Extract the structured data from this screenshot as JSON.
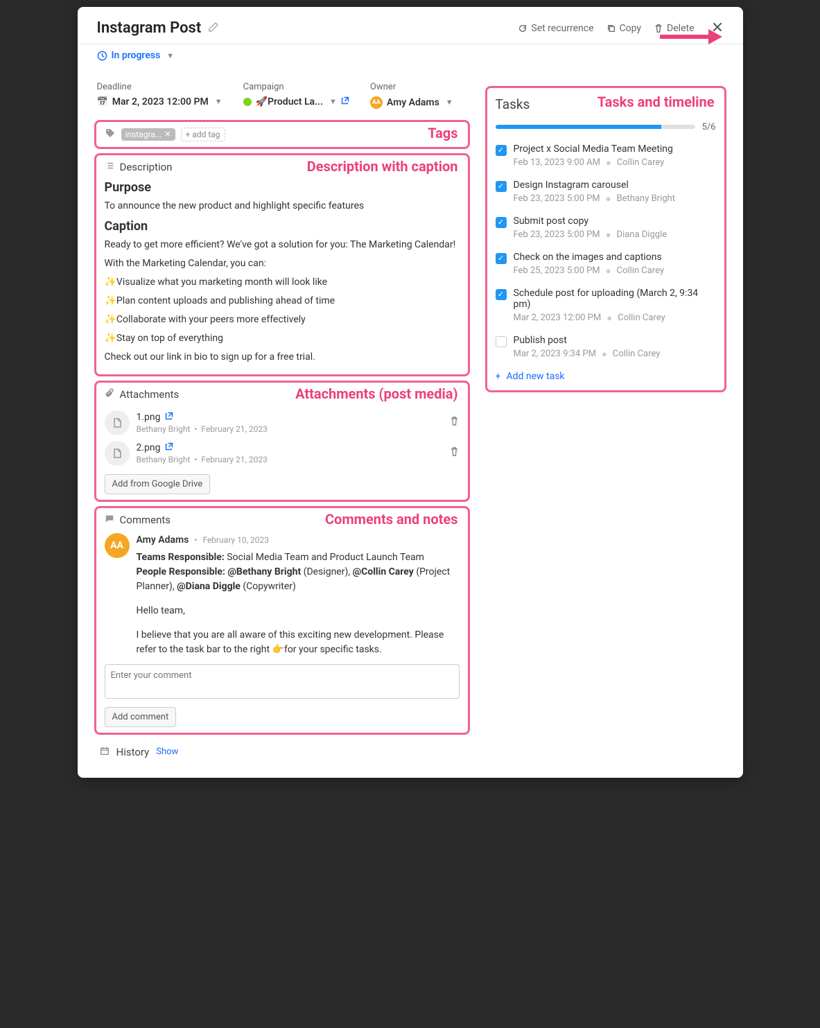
{
  "header": {
    "title": "Instagram Post",
    "set_recurrence": "Set recurrence",
    "copy": "Copy",
    "delete": "Delete"
  },
  "status": {
    "label": "In progress"
  },
  "meta": {
    "deadline_label": "Deadline",
    "deadline_value": "Mar 2, 2023 12:00 PM",
    "campaign_label": "Campaign",
    "campaign_value": "🚀Product La...",
    "campaign_color": "#7ed321",
    "owner_label": "Owner",
    "owner_name": "Amy Adams",
    "owner_initials": "AA"
  },
  "tags": {
    "anno": "Tags",
    "chip": "instagra...",
    "add_label": "add tag"
  },
  "description": {
    "anno": "Description with caption",
    "section": "Description",
    "h1": "Purpose",
    "p1": "To announce the new product and highlight specific features",
    "h2": "Caption",
    "p2": "Ready to get more efficient? We've got a solution for you: The Marketing Calendar!",
    "p3": "With the Marketing Calendar, you can:",
    "b1": "✨Visualize what you marketing month will look like",
    "b2": "✨Plan content uploads and publishing ahead of time",
    "b3": "✨Collaborate with your peers more effectively",
    "b4": "✨Stay on top of everything",
    "p4": "Check out our link in bio to sign up for a free trial."
  },
  "attachments": {
    "anno": "Attachments (post media)",
    "section": "Attachments",
    "items": [
      {
        "name": "1.png",
        "author": "Bethany Bright",
        "date": "February 21, 2023"
      },
      {
        "name": "2.png",
        "author": "Bethany Bright",
        "date": "February 21, 2023"
      }
    ],
    "gdrive": "Add from Google Drive"
  },
  "comments": {
    "anno": "Comments and notes",
    "section": "Comments",
    "author": "Amy Adams",
    "initials": "AA",
    "date": "February 10, 2023",
    "teams_label": "Teams Responsible:",
    "teams_value": "Social Media Team and Product Launch Team",
    "people_label": "People Responsible:",
    "p1": "@Bethany Bright",
    "p1r": "(Designer),",
    "p2": "@Collin Carey",
    "p2r": "(Project Planner),",
    "p3": "@Diana Diggle",
    "p3r": "(Copywriter)",
    "greeting": "Hello team,",
    "body": "I believe that you are all aware of this exciting new development. Please refer to the task bar to the right 👉for your specific tasks.",
    "placeholder": "Enter your comment",
    "add_btn": "Add comment"
  },
  "history": {
    "label": "History",
    "show": "Show"
  },
  "tasks": {
    "anno": "Tasks and timeline",
    "title": "Tasks",
    "progress_pct": 83,
    "progress_text": "5/6",
    "items": [
      {
        "done": true,
        "title": "Project x Social Media Team Meeting",
        "date": "Feb 13, 2023 9:00 AM",
        "owner": "Collin Carey"
      },
      {
        "done": true,
        "title": "Design Instagram carousel",
        "date": "Feb 23, 2023 5:00 PM",
        "owner": "Bethany Bright"
      },
      {
        "done": true,
        "title": "Submit post copy",
        "date": "Feb 23, 2023 5:00 PM",
        "owner": "Diana Diggle"
      },
      {
        "done": true,
        "title": "Check on the images and captions",
        "date": "Feb 25, 2023 5:00 PM",
        "owner": "Collin Carey"
      },
      {
        "done": true,
        "title": "Schedule post for uploading (March 2, 9:34 pm)",
        "date": "Mar 2, 2023 12:00 PM",
        "owner": "Collin Carey"
      },
      {
        "done": false,
        "title": "Publish post",
        "date": "Mar 2, 2023 9:34 PM",
        "owner": "Collin Carey"
      }
    ],
    "add": "Add new task"
  }
}
